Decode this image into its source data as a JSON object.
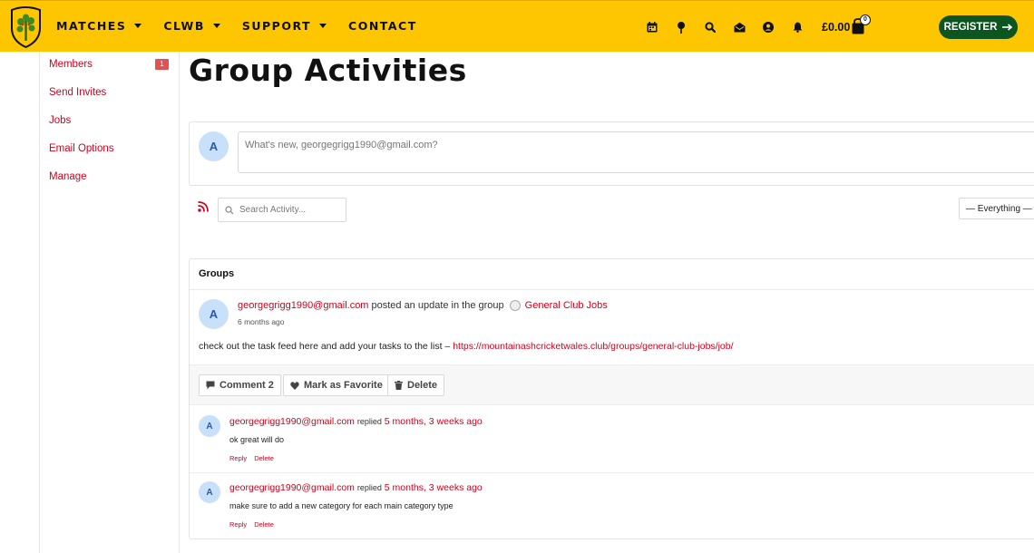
{
  "header": {
    "nav": [
      {
        "label": "MATCHES",
        "dropdown": true
      },
      {
        "label": "CLWB",
        "dropdown": true
      },
      {
        "label": "SUPPORT",
        "dropdown": true
      },
      {
        "label": "CONTACT",
        "dropdown": false
      }
    ],
    "icons": [
      "calendar-icon",
      "map-pin-icon",
      "search-icon",
      "envelope-icon",
      "user-circle-icon",
      "bell-icon"
    ],
    "cart_amount": "£0.00",
    "cart_count": "0",
    "register_label": "REGISTER",
    "colors": {
      "header_bg": "#fec601",
      "register_bg": "#0c5520"
    }
  },
  "sidebar": {
    "items": [
      {
        "label": "Members",
        "badge": "1"
      },
      {
        "label": "Send Invites"
      },
      {
        "label": "Jobs"
      },
      {
        "label": "Email Options"
      },
      {
        "label": "Manage"
      }
    ],
    "link_color": "#d0021b"
  },
  "main": {
    "title": "Group Activities",
    "post_box": {
      "avatar_letter": "A",
      "placeholder": "What's new, georgegrigg1990@gmail.com?"
    },
    "search_placeholder": "Search Activity...",
    "filter_selected": "— Everything —",
    "activity": {
      "section_label": "Groups",
      "avatar_letter": "A",
      "author": "georgegrigg1990@gmail.com",
      "action_text": "posted an update in the group",
      "group_name": "General Club Jobs",
      "time": "6 months ago",
      "content_text": "check out the task feed here and add your tasks to the list –",
      "content_link": "https://mountainashcricketwales.club/groups/general-club-jobs/job/",
      "buttons": {
        "comment": "Comment 2",
        "favorite": "Mark as Favorite",
        "delete": "Delete"
      },
      "replies": [
        {
          "avatar_letter": "A",
          "author": "georgegrigg1990@gmail.com",
          "verb": "replied",
          "time": "5 months, 3 weeks ago",
          "text": "ok great will do",
          "reply_label": "Reply",
          "delete_label": "Delete"
        },
        {
          "avatar_letter": "A",
          "author": "georgegrigg1990@gmail.com",
          "verb": "replied",
          "time": "5 months, 3 weeks ago",
          "text": "make sure to add a new category for each main category type",
          "reply_label": "Reply",
          "delete_label": "Delete"
        }
      ]
    }
  }
}
